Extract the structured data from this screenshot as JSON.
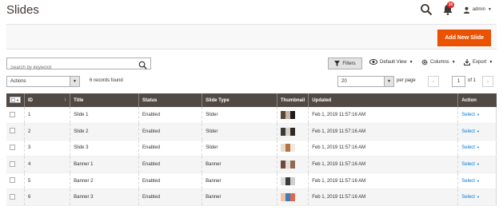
{
  "header": {
    "title": "Slides",
    "notification_count": "10",
    "user_name": "admin"
  },
  "action_bar": {
    "add_button": "Add New Slide"
  },
  "search": {
    "placeholder": "Search by keyword",
    "value": ""
  },
  "toolbar": {
    "filters_label": "Filters",
    "view_label": "Default View",
    "columns_label": "Columns",
    "export_label": "Export"
  },
  "mass_actions": {
    "selected": "Actions"
  },
  "records_found": "6 records found",
  "pagination": {
    "per_page_value": "20",
    "per_page_label": "per page",
    "current_page": "1",
    "of_label": "of 1"
  },
  "table": {
    "columns": [
      "ID",
      "Title",
      "Status",
      "Slide Type",
      "Thumbnail",
      "Updated",
      "Action"
    ],
    "rows": [
      {
        "id": "1",
        "title": "Slide 1",
        "status": "Enabled",
        "type": "Slider",
        "thumb_colors": [
          "#5a4636",
          "#c9b7a3",
          "#1e1e1e"
        ],
        "updated": "Feb 1, 2019 11:57:16 AM",
        "action": "Select"
      },
      {
        "id": "2",
        "title": "Slide 2",
        "status": "Enabled",
        "type": "Slider",
        "thumb_colors": [
          "#3a3a3a",
          "#d8cfc6",
          "#2a2a2a"
        ],
        "updated": "Feb 1, 2019 11:57:16 AM",
        "action": "Select"
      },
      {
        "id": "3",
        "title": "Slide 3",
        "status": "Enabled",
        "type": "Slider",
        "thumb_colors": [
          "#e6dcd2",
          "#b3743e",
          "#efe9e2"
        ],
        "updated": "Feb 1, 2019 11:57:16 AM",
        "action": "Select"
      },
      {
        "id": "4",
        "title": "Banner 1",
        "status": "Enabled",
        "type": "Banner",
        "thumb_colors": [
          "#6b4b3a",
          "#e7ddd3",
          "#8c6a55"
        ],
        "updated": "Feb 1, 2019 11:57:16 AM",
        "action": "Select"
      },
      {
        "id": "5",
        "title": "Banner 2",
        "status": "Enabled",
        "type": "Banner",
        "thumb_colors": [
          "#dcdcdc",
          "#3c3c3c",
          "#cfcfcf"
        ],
        "updated": "Feb 1, 2019 11:57:16 AM",
        "action": "Select"
      },
      {
        "id": "6",
        "title": "Banner 3",
        "status": "Enabled",
        "type": "Banner",
        "thumb_colors": [
          "#f0c4a8",
          "#3d7fb8",
          "#e06a4f"
        ],
        "updated": "Feb 1, 2019 11:57:16 AM",
        "action": "Select"
      }
    ]
  },
  "colors": {
    "accent": "#eb5202",
    "header_bg": "#514943",
    "link": "#007bdb"
  }
}
